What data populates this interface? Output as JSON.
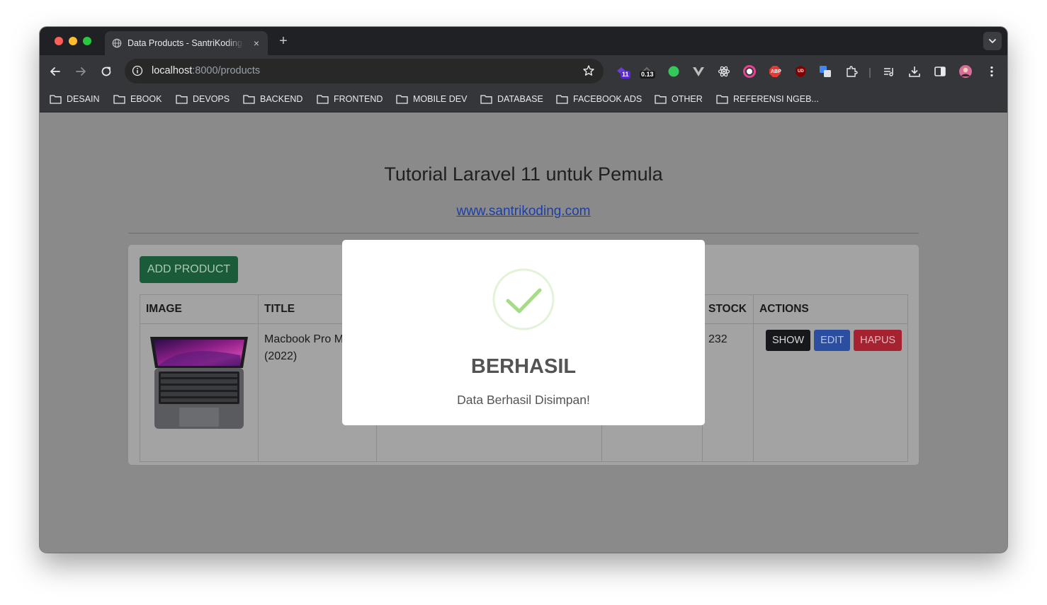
{
  "browser": {
    "tab_title": "Data Products - SantriKoding",
    "tab_close": "×",
    "new_tab": "+",
    "url_host": "localhost",
    "url_path": ":8000/products",
    "extension_badges": {
      "ext1": "11",
      "ext2": "0.13",
      "abp": "ABP",
      "ud": "UD"
    }
  },
  "bookmarks": [
    "DESAIN",
    "EBOOK",
    "DEVOPS",
    "BACKEND",
    "FRONTEND",
    "MOBILE DEV",
    "DATABASE",
    "FACEBOOK ADS",
    "OTHER",
    "REFERENSI NGEB..."
  ],
  "page": {
    "title": "Tutorial Laravel 11 untuk Pemula",
    "link": "www.santrikoding.com",
    "add_button": "ADD PRODUCT",
    "table": {
      "headers": [
        "IMAGE",
        "TITLE",
        "",
        "",
        "STOCK",
        "ACTIONS"
      ],
      "rows": [
        {
          "title": "Macbook Pro M2 (2022)",
          "stock": "232",
          "show": "SHOW",
          "edit": "EDIT",
          "hapus": "HAPUS"
        }
      ]
    }
  },
  "modal": {
    "title": "BERHASIL",
    "text": "Data Berhasil Disimpan!"
  },
  "colors": {
    "success_green": "#a5dc86",
    "add_button": "#1a5c3a",
    "show_button": "#16181b",
    "edit_button": "#2c4ea0",
    "hapus_button": "#a52230"
  }
}
